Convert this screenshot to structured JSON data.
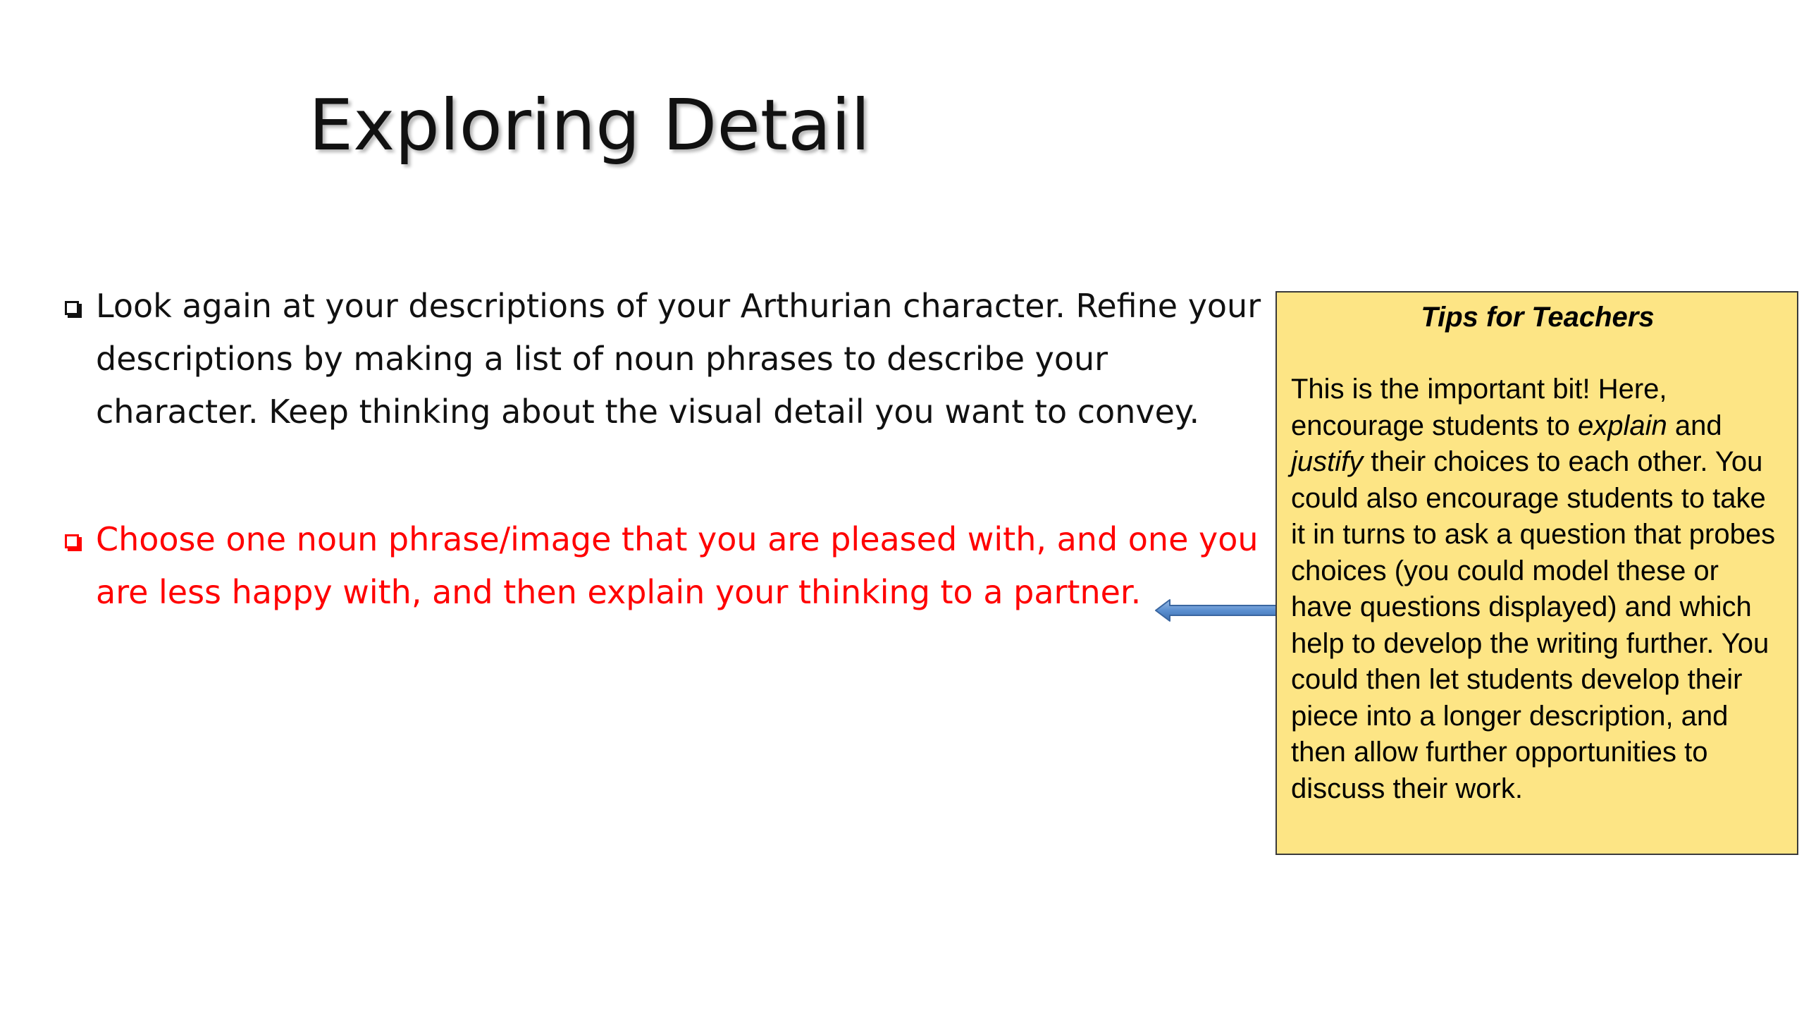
{
  "slide": {
    "title": "Exploring Detail",
    "bullets": [
      "Look again at your descriptions of your Arthurian character. Refine your descriptions by making a list of noun phrases to describe your character. Keep thinking about the visual detail you want to convey.",
      "Choose one noun phrase/image that you are pleased with, and one you are less happy with, and then explain your thinking to a partner."
    ]
  },
  "tips": {
    "title": "Tips for Teachers",
    "body_part1": "This is the important bit! Here, encourage students to ",
    "em1": "explain",
    "body_part2": " and ",
    "em2": "justify",
    "body_part3": " their choices to each other. You could also encourage students to take it in turns to ask a question that probes choices (you could model these or have questions displayed) and which help to develop the writing further. You could then let students develop their piece into a longer description, and then allow further opportunities to discuss their work."
  },
  "colors": {
    "highlight_text": "#ff0000",
    "tips_background": "#fde585",
    "arrow": "#4f81bd"
  },
  "icons": {
    "bullet": "checkbox-icon",
    "pointer": "left-arrow-icon"
  }
}
